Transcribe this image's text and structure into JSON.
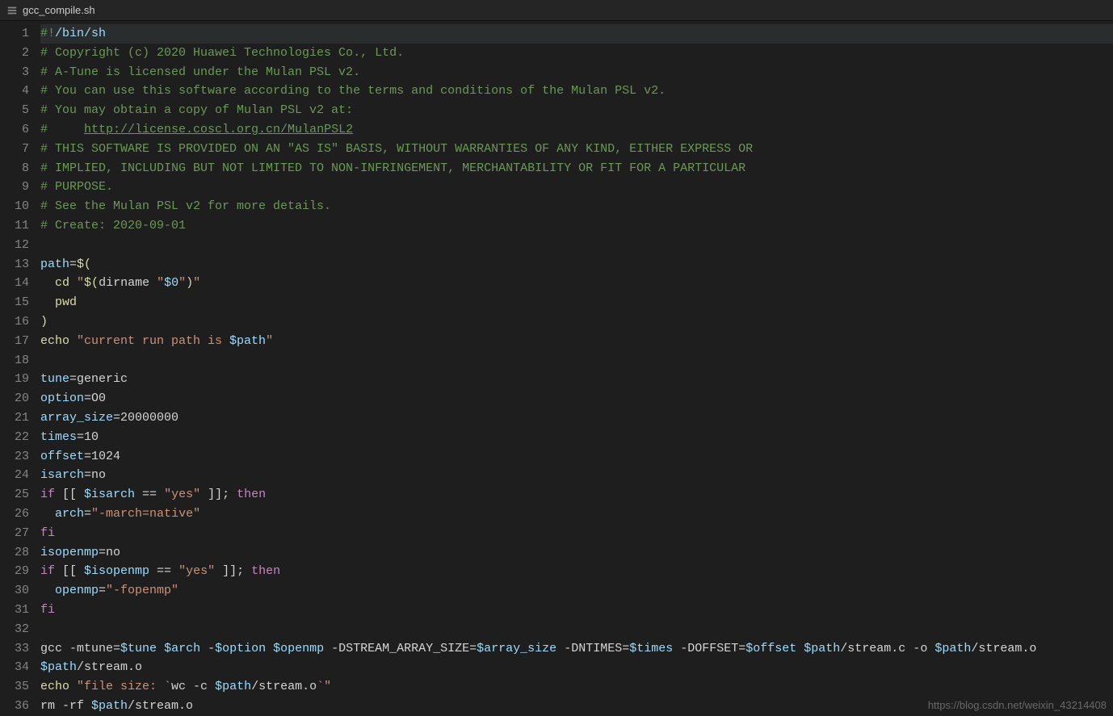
{
  "tab": {
    "filename": "gcc_compile.sh"
  },
  "watermark": "https://blog.csdn.net/weixin_43214408",
  "lines": [
    {
      "n": 1,
      "hl": true,
      "tokens": [
        [
          "c-comment",
          "#!"
        ],
        [
          "c-strvar",
          "/bin/sh"
        ]
      ]
    },
    {
      "n": 2,
      "tokens": [
        [
          "c-comment",
          "# Copyright (c) 2020 Huawei Technologies Co., Ltd."
        ]
      ]
    },
    {
      "n": 3,
      "tokens": [
        [
          "c-comment",
          "# A-Tune is licensed under the Mulan PSL v2."
        ]
      ]
    },
    {
      "n": 4,
      "tokens": [
        [
          "c-comment",
          "# You can use this software according to the terms and conditions of the Mulan PSL v2."
        ]
      ]
    },
    {
      "n": 5,
      "tokens": [
        [
          "c-comment",
          "# You may obtain a copy of Mulan PSL v2 at:"
        ]
      ]
    },
    {
      "n": 6,
      "tokens": [
        [
          "c-comment",
          "#     "
        ],
        [
          "c-link",
          "http://license.coscl.org.cn/MulanPSL2"
        ]
      ]
    },
    {
      "n": 7,
      "tokens": [
        [
          "c-comment",
          "# THIS SOFTWARE IS PROVIDED ON AN \"AS IS\" BASIS, WITHOUT WARRANTIES OF ANY KIND, EITHER EXPRESS OR"
        ]
      ]
    },
    {
      "n": 8,
      "tokens": [
        [
          "c-comment",
          "# IMPLIED, INCLUDING BUT NOT LIMITED TO NON-INFRINGEMENT, MERCHANTABILITY OR FIT FOR A PARTICULAR"
        ]
      ]
    },
    {
      "n": 9,
      "tokens": [
        [
          "c-comment",
          "# PURPOSE."
        ]
      ]
    },
    {
      "n": 10,
      "tokens": [
        [
          "c-comment",
          "# See the Mulan PSL v2 for more details."
        ]
      ]
    },
    {
      "n": 11,
      "tokens": [
        [
          "c-comment",
          "# Create: 2020-09-01"
        ]
      ]
    },
    {
      "n": 12,
      "tokens": [
        [
          "c-plain",
          ""
        ]
      ]
    },
    {
      "n": 13,
      "tokens": [
        [
          "c-var",
          "path"
        ],
        [
          "c-op",
          "="
        ],
        [
          "c-cmd",
          "$("
        ]
      ]
    },
    {
      "n": 14,
      "tokens": [
        [
          "guide",
          "  "
        ],
        [
          "c-cmd",
          "cd "
        ],
        [
          "c-str",
          "\""
        ],
        [
          "c-cmd",
          "$("
        ],
        [
          "c-plain",
          "dirname "
        ],
        [
          "c-str",
          "\""
        ],
        [
          "c-strvar",
          "$0"
        ],
        [
          "c-str",
          "\""
        ],
        [
          "c-cmd",
          ")"
        ],
        [
          "c-str",
          "\""
        ]
      ]
    },
    {
      "n": 15,
      "tokens": [
        [
          "guide",
          "  "
        ],
        [
          "c-cmd",
          "pwd"
        ]
      ]
    },
    {
      "n": 16,
      "tokens": [
        [
          "c-cmd",
          ")"
        ]
      ]
    },
    {
      "n": 17,
      "tokens": [
        [
          "c-cmd",
          "echo "
        ],
        [
          "c-str",
          "\"current run path is "
        ],
        [
          "c-strvar",
          "$path"
        ],
        [
          "c-str",
          "\""
        ]
      ]
    },
    {
      "n": 18,
      "tokens": [
        [
          "c-plain",
          ""
        ]
      ]
    },
    {
      "n": 19,
      "tokens": [
        [
          "c-var",
          "tune"
        ],
        [
          "c-op",
          "="
        ],
        [
          "c-plain",
          "generic"
        ]
      ]
    },
    {
      "n": 20,
      "tokens": [
        [
          "c-var",
          "option"
        ],
        [
          "c-op",
          "="
        ],
        [
          "c-plain",
          "O0"
        ]
      ]
    },
    {
      "n": 21,
      "tokens": [
        [
          "c-var",
          "array_size"
        ],
        [
          "c-op",
          "="
        ],
        [
          "c-plain",
          "20000000"
        ]
      ]
    },
    {
      "n": 22,
      "tokens": [
        [
          "c-var",
          "times"
        ],
        [
          "c-op",
          "="
        ],
        [
          "c-plain",
          "10"
        ]
      ]
    },
    {
      "n": 23,
      "tokens": [
        [
          "c-var",
          "offset"
        ],
        [
          "c-op",
          "="
        ],
        [
          "c-plain",
          "1024"
        ]
      ]
    },
    {
      "n": 24,
      "tokens": [
        [
          "c-var",
          "isarch"
        ],
        [
          "c-op",
          "="
        ],
        [
          "c-plain",
          "no"
        ]
      ]
    },
    {
      "n": 25,
      "tokens": [
        [
          "c-kw",
          "if"
        ],
        [
          "c-plain",
          " [[ "
        ],
        [
          "c-strvar",
          "$isarch"
        ],
        [
          "c-plain",
          " == "
        ],
        [
          "c-str",
          "\"yes\""
        ],
        [
          "c-plain",
          " ]]; "
        ],
        [
          "c-kw",
          "then"
        ]
      ]
    },
    {
      "n": 26,
      "tokens": [
        [
          "guide",
          "  "
        ],
        [
          "c-var",
          "arch"
        ],
        [
          "c-op",
          "="
        ],
        [
          "c-str",
          "\"-march=native\""
        ]
      ]
    },
    {
      "n": 27,
      "tokens": [
        [
          "c-kw",
          "fi"
        ]
      ]
    },
    {
      "n": 28,
      "tokens": [
        [
          "c-var",
          "isopenmp"
        ],
        [
          "c-op",
          "="
        ],
        [
          "c-plain",
          "no"
        ]
      ]
    },
    {
      "n": 29,
      "tokens": [
        [
          "c-kw",
          "if"
        ],
        [
          "c-plain",
          " [[ "
        ],
        [
          "c-strvar",
          "$isopenmp"
        ],
        [
          "c-plain",
          " == "
        ],
        [
          "c-str",
          "\"yes\""
        ],
        [
          "c-plain",
          " ]]; "
        ],
        [
          "c-kw",
          "then"
        ]
      ]
    },
    {
      "n": 30,
      "tokens": [
        [
          "guide",
          "  "
        ],
        [
          "c-var",
          "openmp"
        ],
        [
          "c-op",
          "="
        ],
        [
          "c-str",
          "\"-fopenmp\""
        ]
      ]
    },
    {
      "n": 31,
      "tokens": [
        [
          "c-kw",
          "fi"
        ]
      ]
    },
    {
      "n": 32,
      "tokens": [
        [
          "c-plain",
          ""
        ]
      ]
    },
    {
      "n": 33,
      "tokens": [
        [
          "c-plain",
          "gcc -mtune="
        ],
        [
          "c-strvar",
          "$tune"
        ],
        [
          "c-plain",
          " "
        ],
        [
          "c-strvar",
          "$arch"
        ],
        [
          "c-plain",
          " -"
        ],
        [
          "c-strvar",
          "$option"
        ],
        [
          "c-plain",
          " "
        ],
        [
          "c-strvar",
          "$openmp"
        ],
        [
          "c-plain",
          " -DSTREAM_ARRAY_SIZE="
        ],
        [
          "c-strvar",
          "$array_size"
        ],
        [
          "c-plain",
          " -DNTIMES="
        ],
        [
          "c-strvar",
          "$times"
        ],
        [
          "c-plain",
          " -DOFFSET="
        ],
        [
          "c-strvar",
          "$offset"
        ],
        [
          "c-plain",
          " "
        ],
        [
          "c-strvar",
          "$path"
        ],
        [
          "c-plain",
          "/stream.c -o "
        ],
        [
          "c-strvar",
          "$path"
        ],
        [
          "c-plain",
          "/stream.o"
        ]
      ]
    },
    {
      "n": 34,
      "tokens": [
        [
          "c-strvar",
          "$path"
        ],
        [
          "c-plain",
          "/stream.o"
        ]
      ]
    },
    {
      "n": 35,
      "tokens": [
        [
          "c-cmd",
          "echo "
        ],
        [
          "c-str",
          "\"file size: `"
        ],
        [
          "c-plain",
          "wc -c "
        ],
        [
          "c-strvar",
          "$path"
        ],
        [
          "c-plain",
          "/stream.o"
        ],
        [
          "c-str",
          "`\""
        ]
      ]
    },
    {
      "n": 36,
      "tokens": [
        [
          "c-plain",
          "rm -rf "
        ],
        [
          "c-strvar",
          "$path"
        ],
        [
          "c-plain",
          "/stream.o"
        ]
      ]
    }
  ]
}
